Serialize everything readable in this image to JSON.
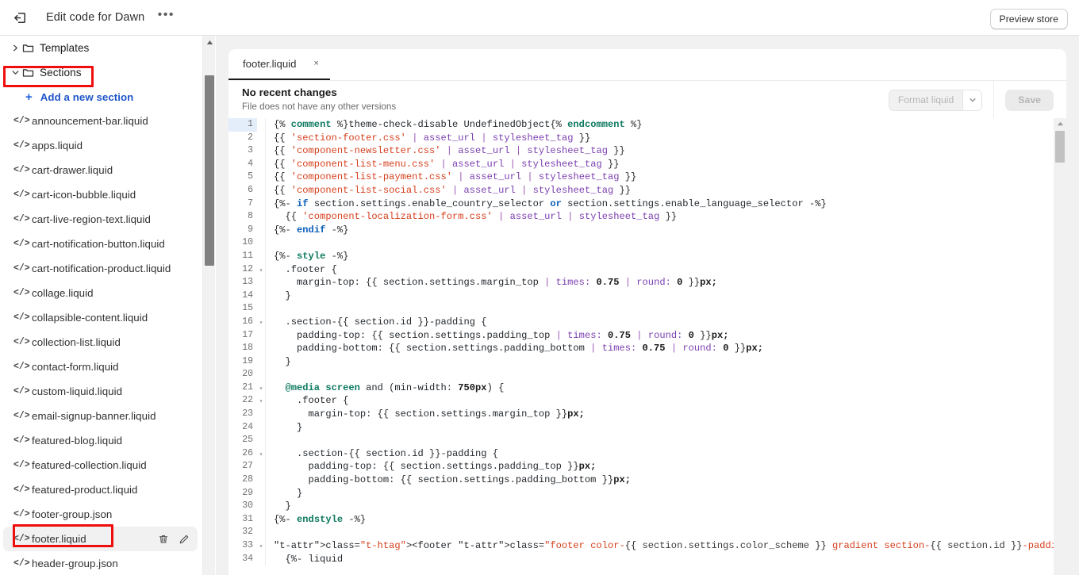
{
  "topbar": {
    "exit_icon": "exit-icon",
    "title": "Edit code for Dawn",
    "more_label": "•••",
    "preview_button": "Preview store"
  },
  "sidebar": {
    "folders": [
      {
        "label": "Templates",
        "expanded": false,
        "caret": "›"
      },
      {
        "label": "Sections",
        "expanded": true,
        "caret": "⌄"
      }
    ],
    "add_link": {
      "plus": "+",
      "label": "Add a new section"
    },
    "file_icon": "</>",
    "files": [
      {
        "name": "announcement-bar.liquid"
      },
      {
        "name": "apps.liquid"
      },
      {
        "name": "cart-drawer.liquid"
      },
      {
        "name": "cart-icon-bubble.liquid"
      },
      {
        "name": "cart-live-region-text.liquid"
      },
      {
        "name": "cart-notification-button.liquid"
      },
      {
        "name": "cart-notification-product.liquid"
      },
      {
        "name": "collage.liquid"
      },
      {
        "name": "collapsible-content.liquid"
      },
      {
        "name": "collection-list.liquid"
      },
      {
        "name": "contact-form.liquid"
      },
      {
        "name": "custom-liquid.liquid"
      },
      {
        "name": "email-signup-banner.liquid"
      },
      {
        "name": "featured-blog.liquid"
      },
      {
        "name": "featured-collection.liquid"
      },
      {
        "name": "featured-product.liquid"
      },
      {
        "name": "footer-group.json"
      },
      {
        "name": "footer.liquid",
        "hovered": true,
        "actions": [
          "delete-icon",
          "rename-icon"
        ]
      },
      {
        "name": "header-group.json"
      }
    ]
  },
  "editor": {
    "tab": {
      "label": "footer.liquid",
      "close": "×"
    },
    "changes_title": "No recent changes",
    "changes_subtitle": "File does not have any other versions",
    "format_button": "Format liquid",
    "format_caret": "⌄",
    "save_button": "Save"
  },
  "code": {
    "active_line": 1,
    "lines": [
      {
        "n": 1,
        "fold": false
      },
      {
        "n": 2,
        "fold": false
      },
      {
        "n": 3,
        "fold": false
      },
      {
        "n": 4,
        "fold": false
      },
      {
        "n": 5,
        "fold": false
      },
      {
        "n": 6,
        "fold": false
      },
      {
        "n": 7,
        "fold": false
      },
      {
        "n": 8,
        "fold": false
      },
      {
        "n": 9,
        "fold": false
      },
      {
        "n": 10,
        "fold": false
      },
      {
        "n": 11,
        "fold": false
      },
      {
        "n": 12,
        "fold": true
      },
      {
        "n": 13,
        "fold": false
      },
      {
        "n": 14,
        "fold": false
      },
      {
        "n": 15,
        "fold": false
      },
      {
        "n": 16,
        "fold": true
      },
      {
        "n": 17,
        "fold": false
      },
      {
        "n": 18,
        "fold": false
      },
      {
        "n": 19,
        "fold": false
      },
      {
        "n": 20,
        "fold": false
      },
      {
        "n": 21,
        "fold": true
      },
      {
        "n": 22,
        "fold": true
      },
      {
        "n": 23,
        "fold": false
      },
      {
        "n": 24,
        "fold": false
      },
      {
        "n": 25,
        "fold": false
      },
      {
        "n": 26,
        "fold": true
      },
      {
        "n": 27,
        "fold": false
      },
      {
        "n": 28,
        "fold": false
      },
      {
        "n": 29,
        "fold": false
      },
      {
        "n": 30,
        "fold": false
      },
      {
        "n": 31,
        "fold": false
      },
      {
        "n": 32,
        "fold": false
      },
      {
        "n": 33,
        "fold": true
      },
      {
        "n": 34,
        "fold": false
      }
    ],
    "text": [
      "{% comment %}theme-check-disable UndefinedObject{% endcomment %}",
      "{{ 'section-footer.css' | asset_url | stylesheet_tag }}",
      "{{ 'component-newsletter.css' | asset_url | stylesheet_tag }}",
      "{{ 'component-list-menu.css' | asset_url | stylesheet_tag }}",
      "{{ 'component-list-payment.css' | asset_url | stylesheet_tag }}",
      "{{ 'component-list-social.css' | asset_url | stylesheet_tag }}",
      "{%- if section.settings.enable_country_selector or section.settings.enable_language_selector -%}",
      "  {{ 'component-localization-form.css' | asset_url | stylesheet_tag }}",
      "{%- endif -%}",
      "",
      "{%- style -%}",
      "  .footer {",
      "    margin-top: {{ section.settings.margin_top | times: 0.75 | round: 0 }}px;",
      "  }",
      "",
      "  .section-{{ section.id }}-padding {",
      "    padding-top: {{ section.settings.padding_top | times: 0.75 | round: 0 }}px;",
      "    padding-bottom: {{ section.settings.padding_bottom | times: 0.75 | round: 0 }}px;",
      "  }",
      "",
      "  @media screen and (min-width: 750px) {",
      "    .footer {",
      "      margin-top: {{ section.settings.margin_top }}px;",
      "    }",
      "",
      "    .section-{{ section.id }}-padding {",
      "      padding-top: {{ section.settings.padding_top }}px;",
      "      padding-bottom: {{ section.settings.padding_bottom }}px;",
      "    }",
      "  }",
      "{%- endstyle -%}",
      "",
      "<footer class=\"footer color-{{ section.settings.color_scheme }} gradient section-{{ section.id }}-padding\">",
      "  {%- liquid"
    ]
  },
  "annotations": {
    "color": "#f00d0d",
    "boxes": [
      "sections-folder",
      "footer-liquid-file"
    ]
  }
}
